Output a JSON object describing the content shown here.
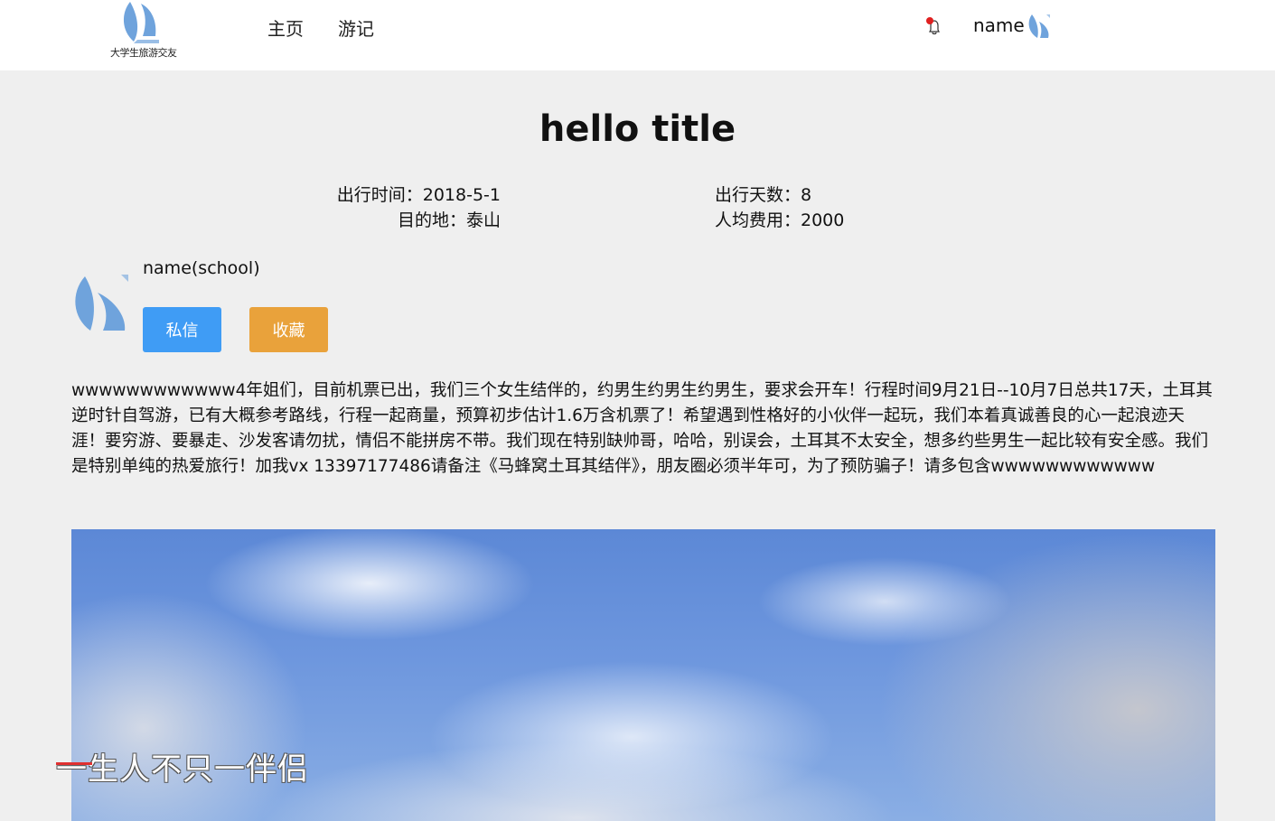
{
  "header": {
    "logo_text": "大学生旅游交友",
    "nav": [
      {
        "label": "主页"
      },
      {
        "label": "游记"
      }
    ],
    "user_name": "name"
  },
  "article": {
    "title": "hello title",
    "meta": {
      "travel_time": "出行时间：2018-5-1",
      "destination": "目的地：泰山",
      "travel_days": "出行天数：8",
      "cost_per_person": "人均费用：2000"
    },
    "author": {
      "name": "name(school)",
      "message_label": "私信",
      "favorite_label": "收藏"
    },
    "content": "wwwwwwwwwwww4年姐们，目前机票已出，我们三个女生结伴的，约男生约男生约男生，要求会开车！行程时间9月21日--10月7日总共17天，土耳其逆时针自驾游，已有大概参考路线，行程一起商量，预算初步估计1.6万含机票了！希望遇到性格好的小伙伴一起玩，我们本着真诚善良的心一起浪迹天涯！要穷游、要暴走、沙发客请勿扰，情侣不能拼房不带。我们现在特别缺帅哥，哈哈，别误会，土耳其不太安全，想多约些男生一起比较有安全感。我们是特别单纯的热爱旅行！加我vx 13397177486请备注《马蜂窝土耳其结伴》，朋友圈必须半年可，为了预防骗子！请多包含wwwwwwwwwwww",
    "photo_caption": "一生人不只一伴侣"
  },
  "colors": {
    "message_button": "#3f9cf5",
    "favorite_button": "#e9a23b",
    "notification_dot": "#e02020",
    "logo_blue": "#6fa3dc"
  }
}
